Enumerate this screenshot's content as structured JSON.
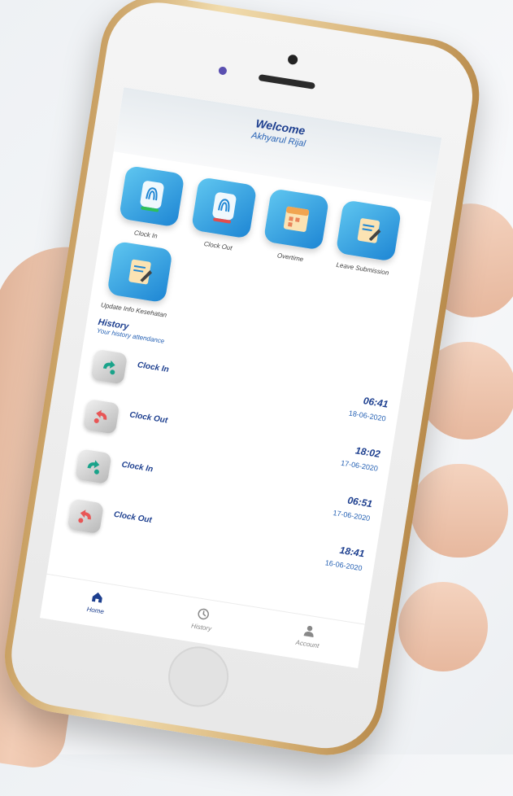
{
  "header": {
    "welcome": "Welcome",
    "username": "Akhyarul Rijal"
  },
  "menu": [
    {
      "label": "Clock In",
      "icon": "fingerprint-in-icon"
    },
    {
      "label": "Clock Out",
      "icon": "fingerprint-out-icon"
    },
    {
      "label": "Overtime",
      "icon": "overtime-icon"
    },
    {
      "label": "Leave Submission",
      "icon": "leave-submission-icon"
    },
    {
      "label": "Update Info Kesehatan",
      "icon": "update-info-icon"
    }
  ],
  "history": {
    "title": "History",
    "subtitle": "Your history attendance",
    "items": [
      {
        "label": "Clock In",
        "time": "06:41",
        "date": "18-06-2020",
        "kind": "in"
      },
      {
        "label": "Clock Out",
        "time": "18:02",
        "date": "17-06-2020",
        "kind": "out"
      },
      {
        "label": "Clock In",
        "time": "06:51",
        "date": "17-06-2020",
        "kind": "in"
      },
      {
        "label": "Clock Out",
        "time": "18:41",
        "date": "16-06-2020",
        "kind": "out"
      }
    ]
  },
  "nav": [
    {
      "label": "Home",
      "icon": "home-icon"
    },
    {
      "label": "History",
      "icon": "history-icon"
    },
    {
      "label": "Account",
      "icon": "account-icon"
    }
  ],
  "colors": {
    "primary": "#1d3f8f",
    "accent": "#2561b4",
    "tile": "#1e86d4",
    "in": "#19a38a",
    "out": "#e85656"
  }
}
